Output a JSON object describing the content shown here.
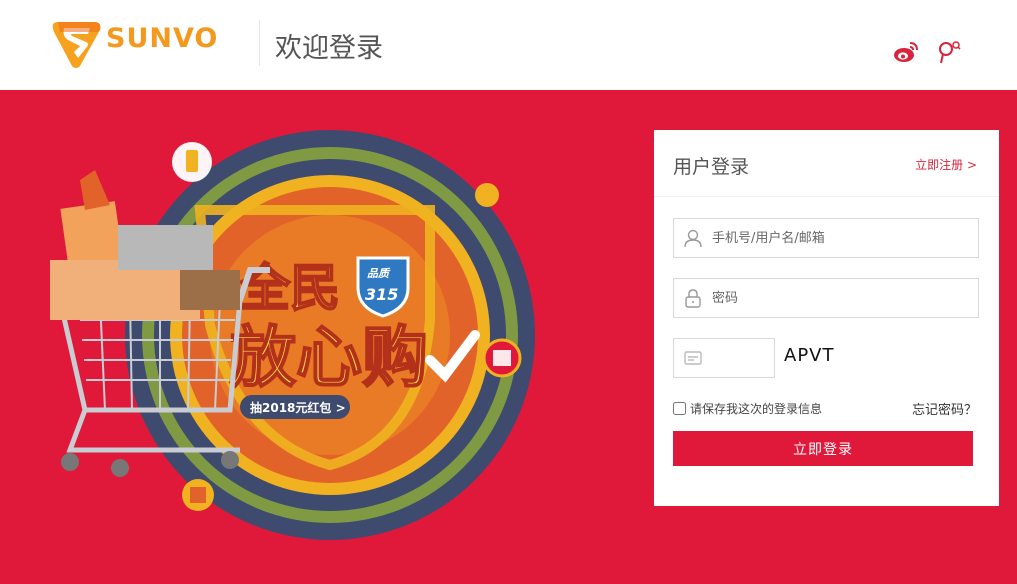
{
  "header": {
    "logo_text": "SUNVO",
    "welcome_title": "欢迎登录"
  },
  "promo": {
    "headline_top": "全民",
    "headline_main": "放心购",
    "badge_top": "品质",
    "badge_num": "315",
    "subline": "抽2018元红包 >"
  },
  "login": {
    "title": "用户登录",
    "register_link": "立即注册 >",
    "username_placeholder": "手机号/用户名/邮箱",
    "password_placeholder": "密码",
    "captcha_text": "APVT",
    "remember_label": "请保存我这次的登录信息",
    "forgot_link": "忘记密码？",
    "submit_label": "立即登录"
  },
  "colors": {
    "brand_red": "#e0193a",
    "logo_orange": "#f39a1e"
  },
  "icons": [
    "weibo-icon",
    "pin-icon",
    "user-icon",
    "lock-icon",
    "card-icon"
  ]
}
